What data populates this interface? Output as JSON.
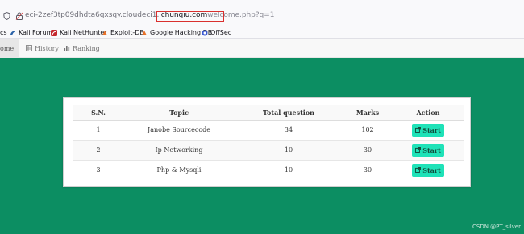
{
  "browser": {
    "url_prefix": "eci-2zef3tp09dhdta6qxsqy.cloudeci1.",
    "url_host": "ichunqiu.com",
    "url_path": "welcome.php?q=1"
  },
  "bookmarks": [
    {
      "label": "cs",
      "icon": "bookmark-partial-icon",
      "color": "#b0b0b8"
    },
    {
      "label": "Kali Forums",
      "icon": "kali-forums-icon",
      "color": "#2a62a8"
    },
    {
      "label": "Kali NetHunter",
      "icon": "kali-nethunter-icon",
      "color": "#c4272d"
    },
    {
      "label": "Exploit-DB",
      "icon": "exploit-db-icon",
      "color": "#e8722a"
    },
    {
      "label": "Google Hacking DB",
      "icon": "ghdb-icon",
      "color": "#e8722a"
    },
    {
      "label": "OffSec",
      "icon": "offsec-icon",
      "color": "#3b5ad2"
    }
  ],
  "nav": {
    "items": [
      {
        "label": "ome",
        "icon": ""
      },
      {
        "label": "History",
        "icon": "list-icon"
      },
      {
        "label": "Ranking",
        "icon": "bar-chart-icon"
      }
    ]
  },
  "table": {
    "headers": [
      "S.N.",
      "Topic",
      "Total question",
      "Marks",
      "Action"
    ],
    "rows": [
      {
        "sn": "1",
        "topic": "Janobe Sourcecode",
        "total": "34",
        "marks": "102",
        "action": "Start"
      },
      {
        "sn": "2",
        "topic": "Ip Networking",
        "total": "10",
        "marks": "30",
        "action": "Start"
      },
      {
        "sn": "3",
        "topic": "Php & Mysqli",
        "total": "10",
        "marks": "30",
        "action": "Start"
      }
    ]
  },
  "watermark": "CSDN @PT_silver",
  "colors": {
    "background": "#0c8e62",
    "button": "#1fe2b8",
    "highlight": "#d9302e"
  }
}
